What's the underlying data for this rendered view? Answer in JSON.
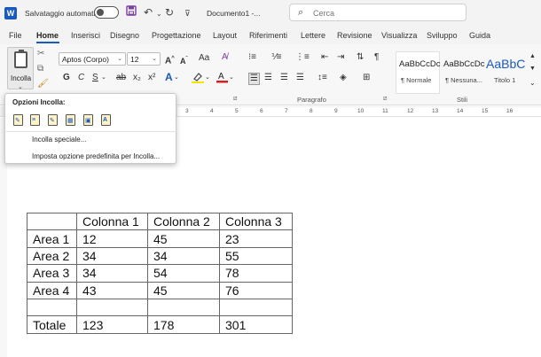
{
  "titlebar": {
    "logo": "W",
    "autosave_label": "Salvataggio automatico",
    "doc_title": "Documento1  -...",
    "search_placeholder": "Cerca",
    "icons": [
      "word-logo",
      "toggle-off",
      "save-icon",
      "undo-icon",
      "redo-icon",
      "customize-icon",
      "search-icon"
    ]
  },
  "menu": {
    "tabs": [
      "File",
      "Home",
      "Inserisci",
      "Disegno",
      "Progettazione",
      "Layout",
      "Riferimenti",
      "Lettere",
      "Revisione",
      "Visualizza",
      "Sviluppo",
      "Guida"
    ],
    "active": "Home"
  },
  "ribbon": {
    "paste_label": "Incolla",
    "font_name": "Aptos (Corpo)",
    "font_size": "12",
    "groups": {
      "paragraph": "Paragrafo",
      "styles": "Stili"
    },
    "styles": [
      {
        "sample": "AaBbCcDc",
        "name": "¶ Normale"
      },
      {
        "sample": "AaBbCcDc",
        "name": "¶ Nessuna..."
      },
      {
        "sample": "AaBbC",
        "name": "Titolo 1"
      }
    ],
    "format_glyphs": {
      "bold": "G",
      "italic": "C",
      "underline": "S",
      "strike": "ab",
      "sub": "x₂",
      "sup": "x²"
    },
    "colors": {
      "highlight": "#f2e600",
      "font_color": "#d92020",
      "accent": "#185abd"
    }
  },
  "ruler": {
    "numbers": [
      "3",
      "4",
      "5",
      "6",
      "7",
      "8",
      "9",
      "10",
      "11",
      "12",
      "13",
      "14",
      "15",
      "16"
    ]
  },
  "paste_menu": {
    "title": "Opzioni Incolla:",
    "items": [
      "Incolla speciale...",
      "Imposta opzione predefinita per Incolla..."
    ]
  },
  "table": {
    "header": [
      "",
      "Colonna 1",
      "Colonna 2",
      "Colonna 3"
    ],
    "rows": [
      [
        "Area 1",
        "12",
        "45",
        "23"
      ],
      [
        "Area 2",
        "34",
        "34",
        "55"
      ],
      [
        "Area 3",
        "34",
        "54",
        "78"
      ],
      [
        "Area 4",
        "43",
        "45",
        "76"
      ],
      [
        "",
        "",
        "",
        ""
      ],
      [
        "Totale",
        "123",
        "178",
        "301"
      ]
    ]
  }
}
